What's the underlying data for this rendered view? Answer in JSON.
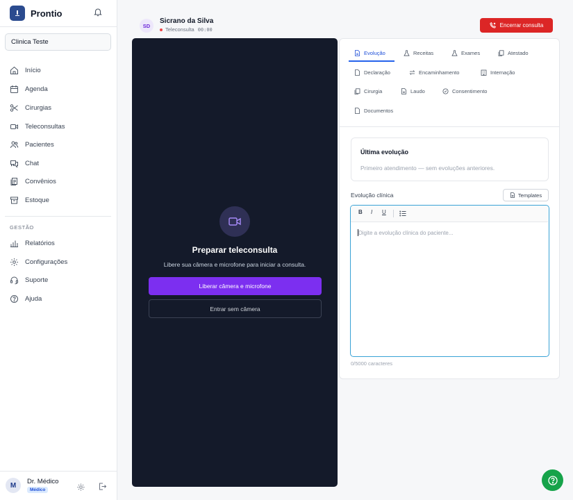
{
  "app": {
    "name": "Prontio"
  },
  "clinic": {
    "name": "Clinica Teste"
  },
  "nav": {
    "items": [
      {
        "label": "Início",
        "icon": "home-icon"
      },
      {
        "label": "Agenda",
        "icon": "calendar-icon"
      },
      {
        "label": "Cirurgias",
        "icon": "scissors-icon"
      },
      {
        "label": "Teleconsultas",
        "icon": "video-icon"
      },
      {
        "label": "Pacientes",
        "icon": "users-icon"
      },
      {
        "label": "Chat",
        "icon": "chat-icon"
      },
      {
        "label": "Convênios",
        "icon": "document-icon"
      },
      {
        "label": "Estoque",
        "icon": "box-icon"
      }
    ],
    "section_label": "GESTÃO",
    "management_items": [
      {
        "label": "Relatórios",
        "icon": "bar-chart-icon"
      },
      {
        "label": "Configurações",
        "icon": "gear-icon"
      },
      {
        "label": "Suporte",
        "icon": "headset-icon"
      },
      {
        "label": "Ajuda",
        "icon": "help-icon"
      }
    ]
  },
  "user": {
    "initial": "M",
    "name": "Dr. Médico",
    "role": "Médico"
  },
  "consultation": {
    "patient_initials": "SD",
    "patient_name": "Sicrano da Silva",
    "mode": "Teleconsulta",
    "timer": "00:00",
    "end_label": "Encerrar consulta"
  },
  "video": {
    "title": "Preparar teleconsulta",
    "subtitle": "Libere sua câmera e microfone para iniciar a consulta.",
    "primary_label": "Liberar câmera e microfone",
    "secondary_label": "Entrar sem câmera"
  },
  "tabs": [
    {
      "label": "Evolução",
      "active": true
    },
    {
      "label": "Receitas"
    },
    {
      "label": "Exames"
    },
    {
      "label": "Atestado"
    },
    {
      "label": "Declaração"
    },
    {
      "label": "Encaminhamento"
    },
    {
      "label": "Internação"
    },
    {
      "label": "Cirurgia"
    },
    {
      "label": "Laudo"
    },
    {
      "label": "Consentimento"
    },
    {
      "label": "Documentos"
    }
  ],
  "last_evolution": {
    "title": "Última evolução",
    "text": "Primeiro atendimento — sem evoluções anteriores."
  },
  "editor": {
    "label": "Evolução clínica",
    "templates_label": "Templates",
    "bold": "B",
    "italic": "I",
    "underline": "U",
    "placeholder": "Digite a evolução clínica do paciente...",
    "counter": "0/5000 caracteres"
  },
  "colors": {
    "brand": "#2b4b8f",
    "danger": "#dc2626",
    "primary": "#7c2ff0",
    "video_bg": "#141a2a",
    "accent": "#2563eb",
    "help": "#16a34a"
  }
}
